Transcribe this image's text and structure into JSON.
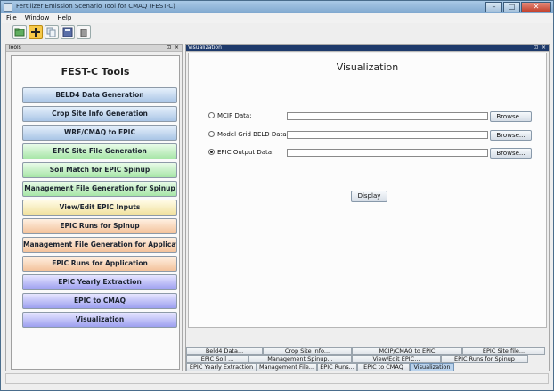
{
  "window": {
    "title": "Fertilizer Emission Scenario Tool for CMAQ (FEST-C)",
    "controls": {
      "minimize": "–",
      "maximize": "□",
      "close": "✕"
    }
  },
  "menubar": {
    "items": [
      "File",
      "Window",
      "Help"
    ]
  },
  "toolbar": {
    "icons": [
      "open-folder-icon",
      "add-icon",
      "copy-icon",
      "save-icon",
      "delete-icon"
    ]
  },
  "tools_panel": {
    "header": "Tools",
    "title": "FEST-C Tools",
    "buttons": [
      {
        "label": "BELD4 Data Generation",
        "color": "blue"
      },
      {
        "label": "Crop Site Info Generation",
        "color": "blue"
      },
      {
        "label": "WRF/CMAQ to EPIC",
        "color": "blue"
      },
      {
        "label": "EPIC Site File Generation",
        "color": "green"
      },
      {
        "label": "Soil Match for EPIC Spinup",
        "color": "green"
      },
      {
        "label": "Management File Generation for Spinup",
        "color": "green"
      },
      {
        "label": "View/Edit EPIC Inputs",
        "color": "yellow"
      },
      {
        "label": "EPIC Runs for Spinup",
        "color": "orange"
      },
      {
        "label": "Management File Generation for Applicat...",
        "color": "orange"
      },
      {
        "label": "EPIC Runs for Application",
        "color": "orange"
      },
      {
        "label": "EPIC Yearly Extraction",
        "color": "violet"
      },
      {
        "label": "EPIC to CMAQ",
        "color": "violet"
      },
      {
        "label": "Visualization",
        "color": "violet"
      }
    ]
  },
  "visualization_panel": {
    "header": "Visualization",
    "title": "Visualization",
    "options": [
      {
        "label": "MCIP Data:",
        "selected": false,
        "value": "",
        "browse": "Browse..."
      },
      {
        "label": "Model Grid BELD Data:",
        "selected": false,
        "value": "",
        "browse": "Browse..."
      },
      {
        "label": "EPIC Output Data:",
        "selected": true,
        "value": "",
        "browse": "Browse..."
      }
    ],
    "display_label": "Display"
  },
  "tabs": {
    "row1": [
      "Beld4 Data...",
      "Crop Site Info...",
      "MCIP/CMAQ to EPIC",
      "EPIC Site file..."
    ],
    "row2": [
      "EPIC Soil ...",
      "Management Spinup...",
      "View/Edit EPIC...",
      "EPIC Runs for Spinup"
    ],
    "row3": [
      "EPIC Yearly Extraction",
      "Management File...",
      "EPIC Runs...",
      "EPIC to CMAQ",
      "Visualization"
    ],
    "active": "Visualization"
  },
  "colors": {
    "title_bar": "#7fa8cf",
    "vis_header": "#1e3a6b",
    "active_tab": "#b9d2ec"
  }
}
